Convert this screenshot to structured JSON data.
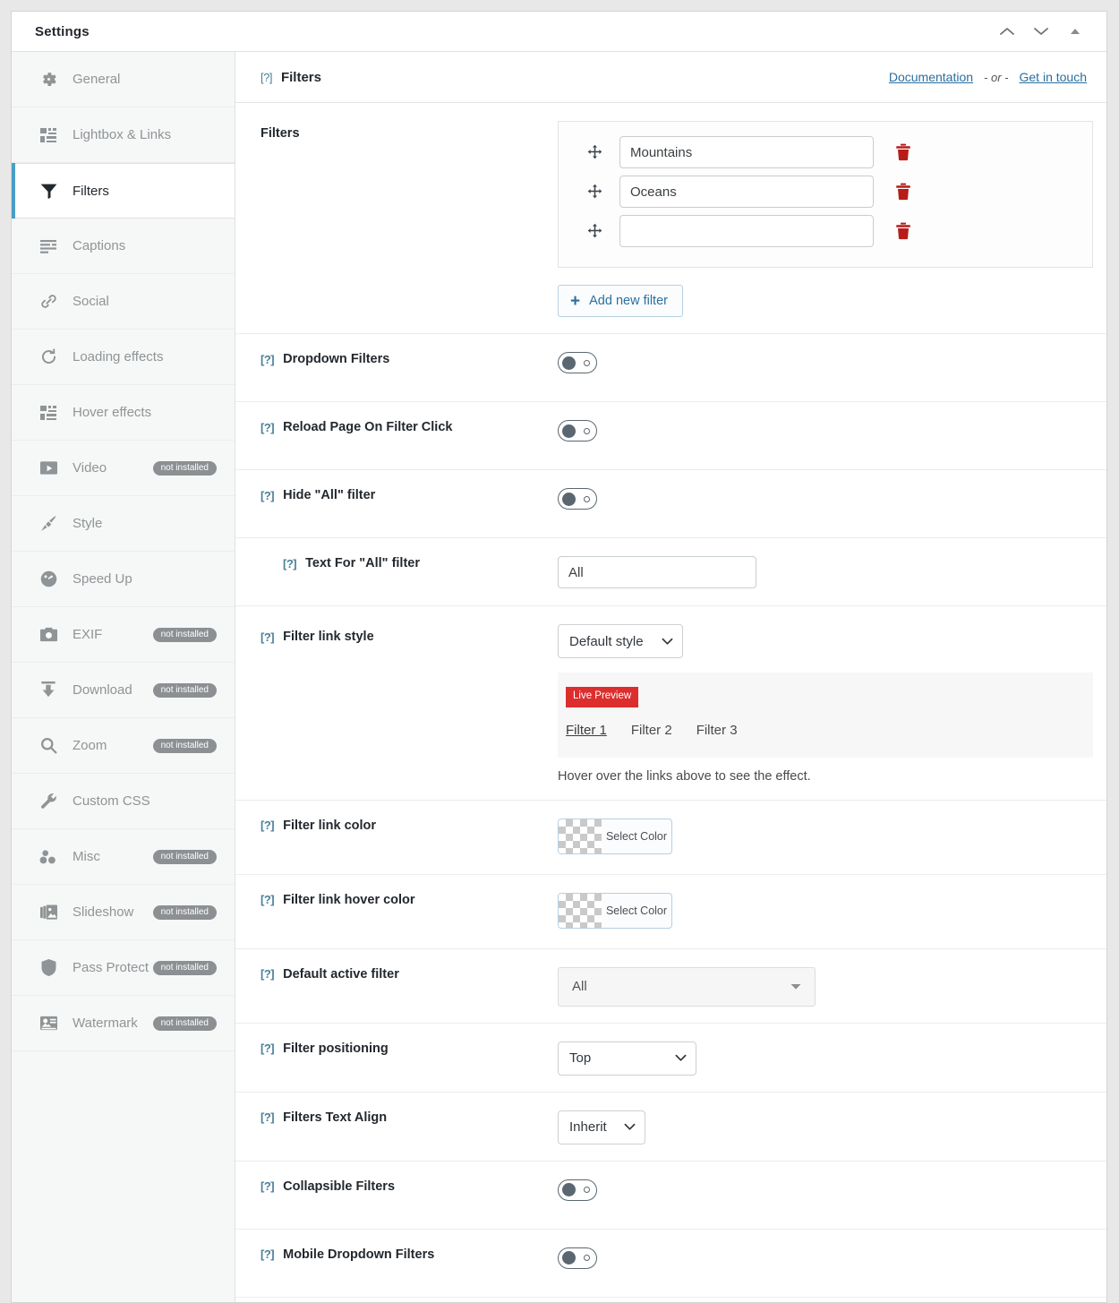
{
  "window": {
    "title": "Settings",
    "controls": [
      {
        "name": "collapse-up-button",
        "icon": "chevron-up-icon"
      },
      {
        "name": "expand-down-button",
        "icon": "chevron-down-icon"
      },
      {
        "name": "scroll-top-button",
        "icon": "triangle-up-icon"
      }
    ]
  },
  "sidebar": {
    "items": [
      {
        "label": "General",
        "icon": "gear-icon",
        "badge": "",
        "active": false
      },
      {
        "label": "Lightbox & Links",
        "icon": "lightbox-icon",
        "badge": "",
        "active": false
      },
      {
        "label": "Filters",
        "icon": "funnel-icon",
        "badge": "",
        "active": true
      },
      {
        "label": "Captions",
        "icon": "captions-icon",
        "badge": "",
        "active": false
      },
      {
        "label": "Social",
        "icon": "link-chain-icon",
        "badge": "",
        "active": false
      },
      {
        "label": "Loading effects",
        "icon": "refresh-icon",
        "badge": "",
        "active": false
      },
      {
        "label": "Hover effects",
        "icon": "hover-icon",
        "badge": "",
        "active": false
      },
      {
        "label": "Video",
        "icon": "play-icon",
        "badge": "not installed",
        "active": false
      },
      {
        "label": "Style",
        "icon": "brush-icon",
        "badge": "",
        "active": false
      },
      {
        "label": "Speed Up",
        "icon": "gauge-icon",
        "badge": "",
        "active": false
      },
      {
        "label": "EXIF",
        "icon": "camera-icon",
        "badge": "not installed",
        "active": false
      },
      {
        "label": "Download",
        "icon": "download-icon",
        "badge": "not installed",
        "active": false
      },
      {
        "label": "Zoom",
        "icon": "magnifier-icon",
        "badge": "not installed",
        "active": false
      },
      {
        "label": "Custom CSS",
        "icon": "wrench-icon",
        "badge": "",
        "active": false
      },
      {
        "label": "Misc",
        "icon": "dots-cluster-icon",
        "badge": "not installed",
        "active": false
      },
      {
        "label": "Slideshow",
        "icon": "slideshow-icon",
        "badge": "not installed",
        "active": false
      },
      {
        "label": "Pass Protect",
        "icon": "shield-icon",
        "badge": "not installed",
        "active": false
      },
      {
        "label": "Watermark",
        "icon": "watermark-icon",
        "badge": "not installed",
        "active": false
      }
    ]
  },
  "panel": {
    "help_mark": "[?]",
    "title": "Filters",
    "documentation_link": "Documentation",
    "or_text": "- or -",
    "contact_link": "Get in touch"
  },
  "rows": {
    "filters": {
      "label": "Filters",
      "items": [
        {
          "value": "Mountains",
          "placeholder": ""
        },
        {
          "value": "Oceans",
          "placeholder": ""
        },
        {
          "value": "",
          "placeholder": ""
        }
      ],
      "add_label": "Add new filter",
      "add_plus": "+"
    },
    "dropdown_filters": {
      "label": "Dropdown Filters",
      "state": "off"
    },
    "reload_page": {
      "label": "Reload Page On Filter Click",
      "state": "off"
    },
    "hide_all_filter": {
      "label": "Hide \"All\" filter",
      "state": "off"
    },
    "text_for_all": {
      "label": "Text For \"All\" filter",
      "value": "All"
    },
    "filter_link_style": {
      "label": "Filter link style",
      "value": "Default style",
      "preview_badge": "Live Preview",
      "preview_links": [
        "Filter 1",
        "Filter 2",
        "Filter 3"
      ],
      "hint": "Hover over the links above to see the effect."
    },
    "filter_link_color": {
      "label": "Filter link color",
      "button": "Select Color"
    },
    "filter_link_hover_color": {
      "label": "Filter link hover color",
      "button": "Select Color"
    },
    "default_active_filter": {
      "label": "Default active filter",
      "value": "All"
    },
    "filter_positioning": {
      "label": "Filter positioning",
      "value": "Top"
    },
    "filters_text_align": {
      "label": "Filters Text Align",
      "value": "Inherit"
    },
    "collapsible_filters": {
      "label": "Collapsible Filters",
      "state": "off"
    },
    "mobile_dropdown_filters": {
      "label": "Mobile Dropdown Filters",
      "state": "off"
    }
  },
  "colors": {
    "accent_blue": "#2a6f9e",
    "active_bar": "#4a9ec4",
    "trash_red": "#b71c18",
    "live_badge_red": "#dd2e2e",
    "toggle_gray": "#5a6770"
  }
}
